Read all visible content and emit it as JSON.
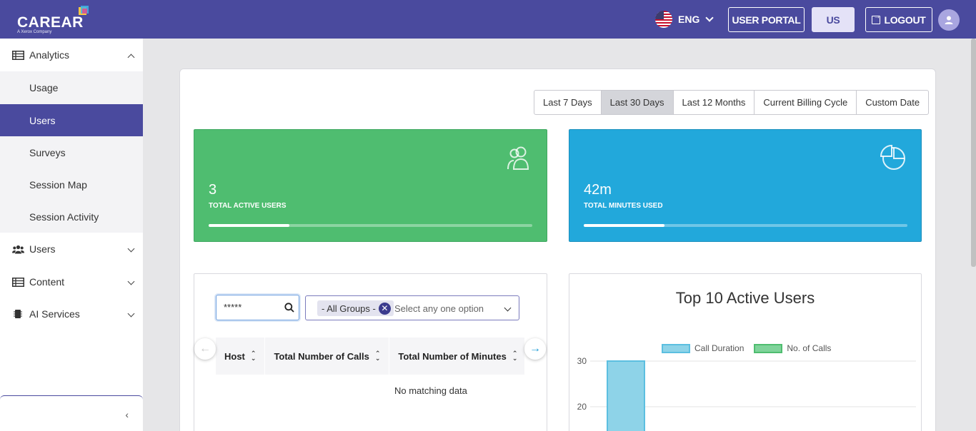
{
  "header": {
    "logo_text": "CAREAR",
    "logo_tagline": "A Xerox Company",
    "language": "ENG",
    "user_portal": "USER PORTAL",
    "region": "US",
    "logout": "LOGOUT"
  },
  "sidebar": {
    "sections": [
      {
        "label": "Analytics",
        "icon": "table-icon",
        "expanded": true
      },
      {
        "label": "Users",
        "icon": "users-icon",
        "expanded": false
      },
      {
        "label": "Content",
        "icon": "table-icon",
        "expanded": false
      },
      {
        "label": "AI Services",
        "icon": "chip-icon",
        "expanded": false
      }
    ],
    "analytics_items": [
      {
        "label": "Usage",
        "active": false
      },
      {
        "label": "Users",
        "active": true
      },
      {
        "label": "Surveys",
        "active": false
      },
      {
        "label": "Session Map",
        "active": false
      },
      {
        "label": "Session Activity",
        "active": false
      }
    ],
    "collapse_icon": "‹"
  },
  "date_range": {
    "options": [
      "Last 7 Days",
      "Last 30 Days",
      "Last 12 Months",
      "Current Billing Cycle",
      "Custom Date"
    ],
    "selected": "Last 30 Days"
  },
  "stats": {
    "active_users": {
      "value": "3",
      "label": "TOTAL ACTIVE USERS",
      "progress": 0.25,
      "icon": "users-outline-icon"
    },
    "minutes_used": {
      "value": "42m",
      "label": "TOTAL MINUTES USED",
      "progress": 0.25,
      "icon": "pie-chart-icon"
    }
  },
  "table": {
    "search_value": "*****",
    "group_chip": "- All Groups -",
    "group_placeholder": "Select any one option",
    "columns": [
      "Host",
      "Total Number of Calls",
      "Total Number of Minutes"
    ],
    "empty_text": "No matching data"
  },
  "chart_data": {
    "type": "bar",
    "title": "Top 10 Active Users",
    "series": [
      {
        "name": "Call Duration",
        "color": "#8ed3e8",
        "values": [
          30
        ]
      },
      {
        "name": "No. of Calls",
        "color": "#7fd39a",
        "values": []
      }
    ],
    "y_ticks": [
      30,
      20
    ],
    "legend_position": "top"
  },
  "colors": {
    "brand": "#4a4a9e",
    "green": "#4fbd70",
    "blue": "#22a8db"
  }
}
